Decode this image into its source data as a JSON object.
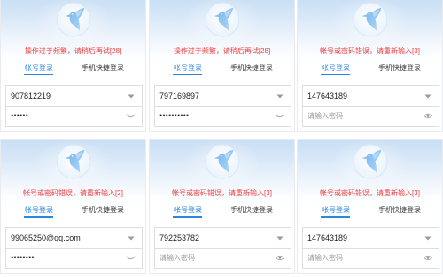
{
  "colors": {
    "accent": "#2b86df",
    "error": "#ee3b3b"
  },
  "logo_icon": "hummingbird-logo-icon",
  "panels": [
    {
      "error": "操作过于频繁，请稍后再试[28]",
      "tabs": [
        {
          "label": "帐号登录",
          "active": true
        },
        {
          "label": "手机快捷登录",
          "active": false
        }
      ],
      "account": {
        "value": "907812219",
        "icon": "dropdown-arrow-icon"
      },
      "password": {
        "value": "••••••",
        "icon": "chevron-down-icon"
      }
    },
    {
      "error": "操作过于频繁，请稍后再试[28]",
      "tabs": [
        {
          "label": "帐号登录",
          "active": true
        },
        {
          "label": "手机快捷登录",
          "active": false
        }
      ],
      "account": {
        "value": "797169897",
        "icon": "dropdown-arrow-icon"
      },
      "password": {
        "value": "••••••••••",
        "icon": "chevron-down-icon"
      }
    },
    {
      "error": "帐号或密码错误，请重新输入[3]",
      "tabs": [
        {
          "label": "帐号登录",
          "active": true
        },
        {
          "label": "手机快捷登录",
          "active": false
        }
      ],
      "account": {
        "value": "147643189",
        "icon": "dropdown-arrow-icon"
      },
      "password": {
        "placeholder": "请输入密码",
        "icon": "eye-icon"
      }
    },
    {
      "error": "帐号或密码错误，请重新输入[2]",
      "tabs": [
        {
          "label": "帐号登录",
          "active": true
        },
        {
          "label": "手机快捷登录",
          "active": false
        }
      ],
      "account": {
        "value": "99065250@qq.com",
        "icon": "dropdown-arrow-icon"
      },
      "password": {
        "value": "••••••••",
        "icon": "chevron-down-icon"
      }
    },
    {
      "error": "帐号或密码错误，请重新输入[3]",
      "tabs": [
        {
          "label": "帐号登录",
          "active": true
        },
        {
          "label": "手机快捷登录",
          "active": false
        }
      ],
      "account": {
        "value": "792253782",
        "icon": "dropdown-arrow-icon"
      },
      "password": {
        "placeholder": "请输入密码",
        "icon": "eye-icon"
      }
    },
    {
      "error": "帐号或密码错误，请重新输入[3]",
      "tabs": [
        {
          "label": "帐号登录",
          "active": true
        },
        {
          "label": "手机快捷登录",
          "active": false
        }
      ],
      "account": {
        "value": "147643189",
        "icon": "dropdown-arrow-icon"
      },
      "password": {
        "placeholder": "请输入密码",
        "icon": "eye-icon"
      }
    }
  ]
}
